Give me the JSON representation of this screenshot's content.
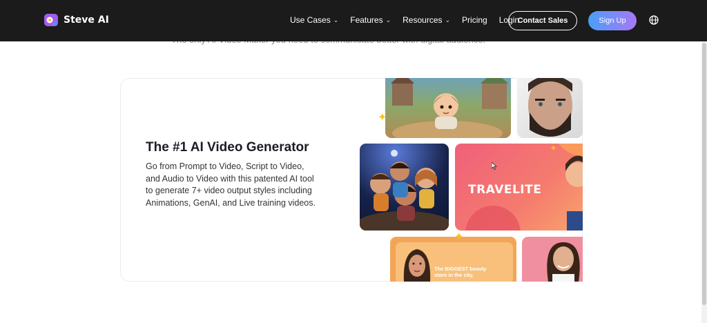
{
  "brand": {
    "name": "Steve AI",
    "mark_color": "#a25cf0"
  },
  "nav": {
    "menu": [
      {
        "label": "Use Cases",
        "has_dropdown": true
      },
      {
        "label": "Features",
        "has_dropdown": true
      },
      {
        "label": "Resources",
        "has_dropdown": true
      },
      {
        "label": "Pricing",
        "has_dropdown": false
      },
      {
        "label": "Login",
        "has_dropdown": false
      }
    ],
    "contact_label": "Contact Sales",
    "signup_label": "Sign Up",
    "globe_icon": "globe-icon"
  },
  "hero": {
    "subtext": "The only AI Video Maker you need to communicate better with digital audience."
  },
  "card": {
    "title": "The #1 AI Video Generator",
    "description": "Go from Prompt to Video, Script to Video, and Audio to Video with this patented AI tool to generate 7+ video output styles including Animations, GenAI, and Live training videos.",
    "tiles": {
      "travel_label": "TRAVELITE",
      "beauty_label": "The BIGGEST beauty store in the city."
    }
  },
  "colors": {
    "nav_bg": "#1b1b1b",
    "signup_gradient_start": "#4a9ff8",
    "signup_gradient_end": "#a878f6",
    "sparkle": "#f7c21b"
  }
}
